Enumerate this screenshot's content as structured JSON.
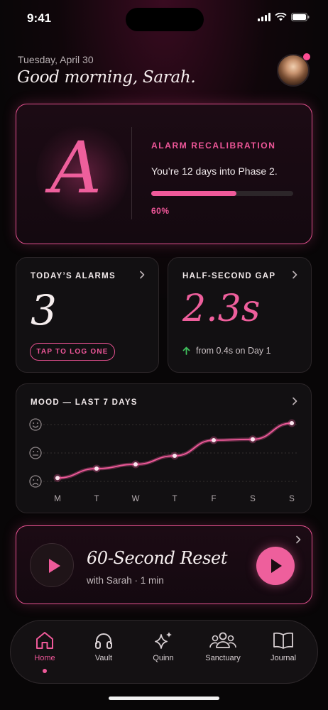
{
  "status_bar": {
    "time": "9:41"
  },
  "header": {
    "date": "Tuesday, April 30",
    "greeting": "Good morning, Sarah."
  },
  "hero": {
    "letter": "A",
    "label": "ALARM RECALIBRATION",
    "text": "You’re 12 days into Phase 2.",
    "progress": 0.6,
    "progress_label": "60%"
  },
  "alarms_card": {
    "label": "TODAY’S ALARMS",
    "count": "3",
    "button_label": "TAP TO LOG ONE"
  },
  "gap_card": {
    "label": "HALF-SECOND GAP",
    "value": "2.3s",
    "subtext": "from 0.4s on Day 1"
  },
  "mood_card": {
    "label": "MOOD — LAST 7 DAYS"
  },
  "chart_data": {
    "type": "line",
    "title": "MOOD — LAST 7 DAYS",
    "categories": [
      "M",
      "T",
      "W",
      "T",
      "F",
      "S",
      "S"
    ],
    "series": [
      {
        "values": [
          0.12,
          0.45,
          0.6,
          0.9,
          1.45,
          1.48,
          2.05
        ]
      }
    ],
    "ylim": [
      0,
      2
    ],
    "y_levels": [
      "sad",
      "neutral",
      "happy"
    ],
    "grid": true,
    "color": "#ef5a9a"
  },
  "reset_card": {
    "title": "60-Second Reset",
    "subtitle": "with Sarah · 1 min"
  },
  "tabs": [
    {
      "label": "Home",
      "icon": "home-icon",
      "active": true
    },
    {
      "label": "Vault",
      "icon": "headphones-icon",
      "active": false
    },
    {
      "label": "Quinn",
      "icon": "sparkle-icon",
      "active": false
    },
    {
      "label": "Sanctuary",
      "icon": "community-icon",
      "active": false
    },
    {
      "label": "Journal",
      "icon": "book-icon",
      "active": false
    }
  ],
  "colors": {
    "accent": "#ef5a9a",
    "background": "#080607",
    "positive": "#3fbf5c"
  }
}
